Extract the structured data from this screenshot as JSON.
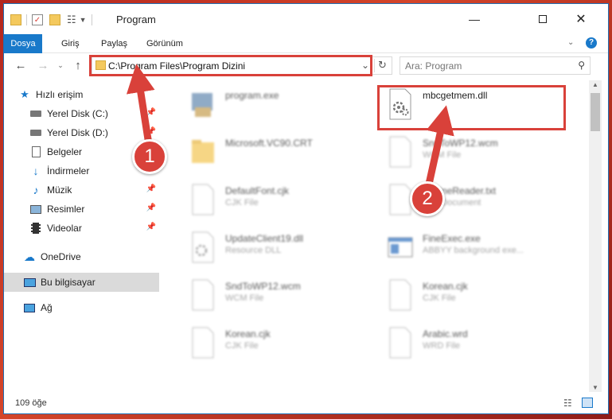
{
  "window": {
    "title": "Program"
  },
  "ribbon": {
    "tabs": [
      {
        "label": "Dosya",
        "active": true
      },
      {
        "label": "Giriş"
      },
      {
        "label": "Paylaş"
      },
      {
        "label": "Görünüm"
      }
    ]
  },
  "navigation": {
    "address": "C:\\Program Files\\Program Dizini",
    "search_placeholder": "Ara: Program"
  },
  "sidebar": {
    "items": [
      {
        "label": "Hızlı erişim",
        "icon": "star-icon"
      },
      {
        "label": "Yerel Disk (C:)",
        "icon": "drive-icon",
        "pinned": true
      },
      {
        "label": "Yerel Disk (D:)",
        "icon": "drive-icon",
        "pinned": true
      },
      {
        "label": "Belgeler",
        "icon": "document-icon",
        "pinned": true
      },
      {
        "label": "İndirmeler",
        "icon": "download-icon",
        "pinned": true
      },
      {
        "label": "Müzik",
        "icon": "music-icon",
        "pinned": true
      },
      {
        "label": "Resimler",
        "icon": "picture-icon",
        "pinned": true
      },
      {
        "label": "Videolar",
        "icon": "video-icon",
        "pinned": true
      },
      {
        "label": "OneDrive",
        "icon": "cloud-icon"
      },
      {
        "label": "Bu bilgisayar",
        "icon": "computer-icon",
        "selected": true
      },
      {
        "label": "Ağ",
        "icon": "network-icon"
      }
    ]
  },
  "files": [
    {
      "name": "program.exe",
      "desc": "",
      "icon": "exe-icon"
    },
    {
      "name": "mbcgetmem.dll",
      "desc": "",
      "icon": "dll-gear-icon"
    },
    {
      "name": "Microsoft.VC90.CRT",
      "desc": "",
      "icon": "folder-icon"
    },
    {
      "name": "SndToWP12.wcm",
      "desc": "WCM File",
      "icon": "file-icon"
    },
    {
      "name": "DefaultFont.cjk",
      "desc": "CJK File",
      "icon": "file-icon"
    },
    {
      "name": "EngineReader.txt",
      "desc": "Text Document",
      "icon": "file-icon"
    },
    {
      "name": "UpdateClient19.dll",
      "desc": "Resource DLL",
      "icon": "dll-gear-icon"
    },
    {
      "name": "FineExec.exe",
      "desc": "ABBYY background exe...",
      "icon": "app-window-icon"
    },
    {
      "name": "SndToWP12.wcm",
      "desc": "WCM File",
      "icon": "file-icon"
    },
    {
      "name": "Korean.cjk",
      "desc": "CJK File",
      "icon": "file-icon"
    },
    {
      "name": "Korean.cjk",
      "desc": "CJK File",
      "icon": "file-icon"
    },
    {
      "name": "Arabic.wrd",
      "desc": "WRD File",
      "icon": "file-icon"
    }
  ],
  "status": {
    "item_count": "109 öğe"
  },
  "annotations": {
    "step1": "1",
    "step2": "2"
  },
  "colors": {
    "accent": "#1979ca",
    "highlight": "#d9413a",
    "folder": "#f4c95d"
  }
}
